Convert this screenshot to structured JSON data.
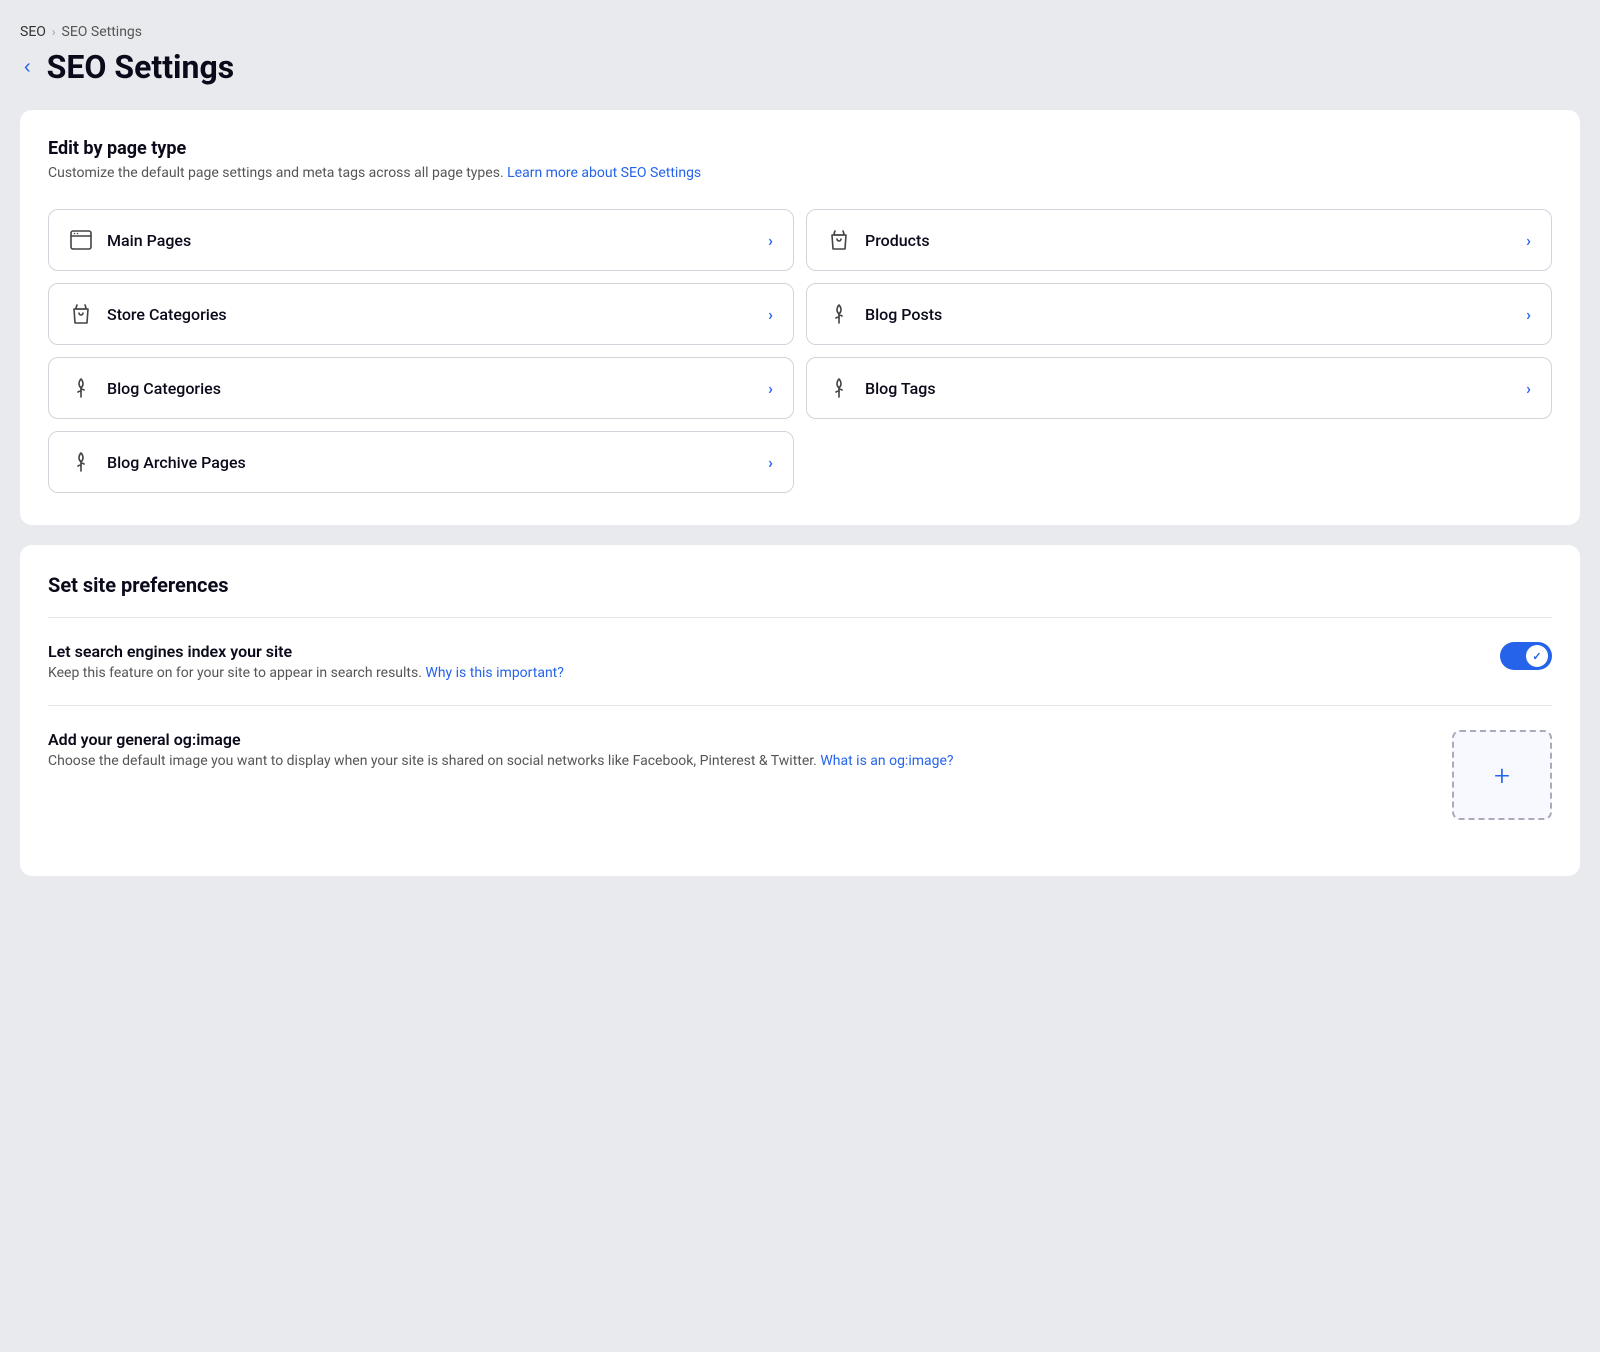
{
  "breadcrumb": {
    "parent": "SEO",
    "separator": "›",
    "current": "SEO Settings"
  },
  "page": {
    "back_label": "‹",
    "title": "SEO Settings"
  },
  "edit_section": {
    "title": "Edit by page type",
    "description": "Customize the default page settings and meta tags across all page types.",
    "learn_more_text": "Learn more about SEO Settings",
    "learn_more_href": "#",
    "items": [
      {
        "id": "main-pages",
        "icon": "browser",
        "label": "Main Pages"
      },
      {
        "id": "products",
        "icon": "tag",
        "label": "Products"
      },
      {
        "id": "store-categories",
        "icon": "tag",
        "label": "Store Categories"
      },
      {
        "id": "blog-posts",
        "icon": "feather",
        "label": "Blog Posts"
      },
      {
        "id": "blog-categories",
        "icon": "feather",
        "label": "Blog Categories"
      },
      {
        "id": "blog-tags",
        "icon": "feather",
        "label": "Blog Tags"
      },
      {
        "id": "blog-archive-pages",
        "icon": "feather",
        "label": "Blog Archive Pages"
      }
    ]
  },
  "preferences_section": {
    "title": "Set site preferences",
    "items": [
      {
        "id": "search-index",
        "title": "Let search engines index your site",
        "description": "Keep this feature on for your site to appear in search results.",
        "link_text": "Why is this important?",
        "link_href": "#",
        "control_type": "toggle",
        "enabled": true
      },
      {
        "id": "og-image",
        "title": "Add your general og:image",
        "description": "Choose the default image you want to display when your site is shared on social networks like Facebook, Pinterest & Twitter.",
        "link_text": "What is an og:image?",
        "link_href": "#",
        "control_type": "image-upload"
      }
    ]
  }
}
